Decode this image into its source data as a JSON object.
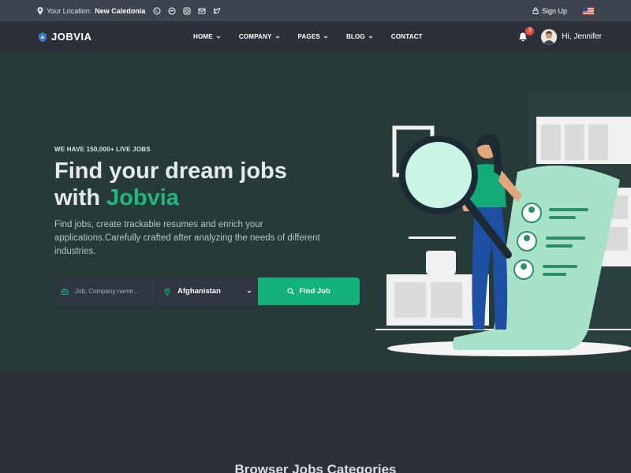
{
  "topbar": {
    "location_label": "Your Location:",
    "location_value": "New Caledonia",
    "signup_label": "Sign Up"
  },
  "navbar": {
    "logo_text": "JOBVIA",
    "menu": [
      {
        "label": "HOME",
        "dropdown": true
      },
      {
        "label": "COMPANY",
        "dropdown": true
      },
      {
        "label": "PAGES",
        "dropdown": true
      },
      {
        "label": "BLOG",
        "dropdown": true
      },
      {
        "label": "CONTACT",
        "dropdown": false
      }
    ],
    "notification_count": "3",
    "greeting": "Hi, Jennifer"
  },
  "hero": {
    "eyebrow": "WE HAVE 150,000+ LIVE JOBS",
    "headline_line1": "Find your dream jobs",
    "headline_line2_prefix": "with ",
    "headline_accent": "Jobvia",
    "description": "Find jobs, create trackable resumes and enrich your applications.Carefully crafted after analyzing the needs of different industries."
  },
  "search": {
    "job_placeholder": "Job, Company name...",
    "location_value": "Afghanistan",
    "button_label": "Find Job"
  },
  "section": {
    "title": "Browser Jobs Categories"
  },
  "colors": {
    "accent": "#13b27a",
    "hero_bg": "#273a3a",
    "topbar_bg": "#3e444d",
    "nav_bg": "#2c3139"
  }
}
